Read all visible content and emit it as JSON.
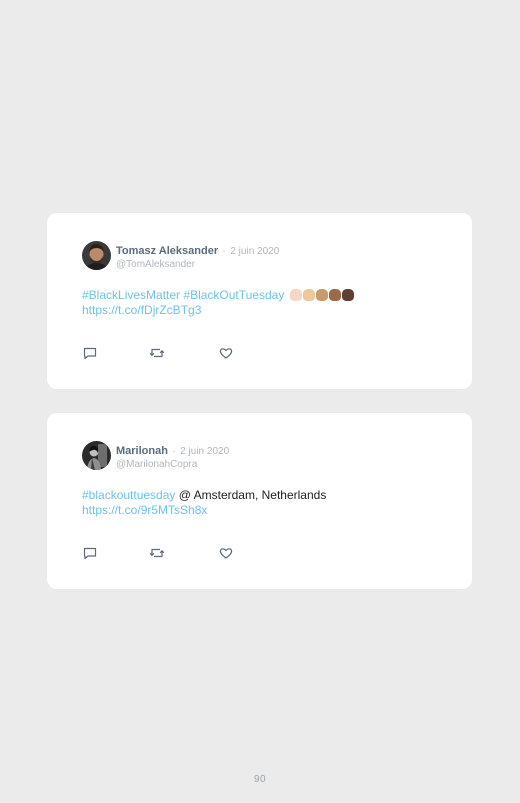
{
  "page": {
    "number": "90"
  },
  "tweets": [
    {
      "author_name": "Tomasz Aleksander",
      "separator": "·",
      "date": "2 juin 2020",
      "handle": "@TomAleksander",
      "hashtag1": "#BlackLivesMatter",
      "hashtag2": "#BlackOutTuesday",
      "emoji": [
        "raised-fist-light",
        "raised-fist-medium-light",
        "raised-fist-medium",
        "raised-fist-medium-dark",
        "raised-fist-dark"
      ],
      "link": "https://t.co/fDjrZcBTg3",
      "actions": [
        "reply-icon",
        "retweet-icon",
        "like-icon"
      ]
    },
    {
      "author_name": "Marilonah",
      "separator": "·",
      "date": "2 juin 2020",
      "handle": "@MarilonahCopra",
      "hashtag": "#blackouttuesday",
      "location": "@ Amsterdam, Netherlands",
      "link": "https://t.co/9r5MTsSh8x",
      "actions": [
        "reply-icon",
        "retweet-icon",
        "like-icon"
      ]
    }
  ],
  "colors": {
    "background": "#ebebeb",
    "card": "#ffffff",
    "link": "#6cc2ea",
    "name": "#5b6b7b",
    "muted": "#b0b6bc",
    "icon": "#5b6b7b"
  }
}
